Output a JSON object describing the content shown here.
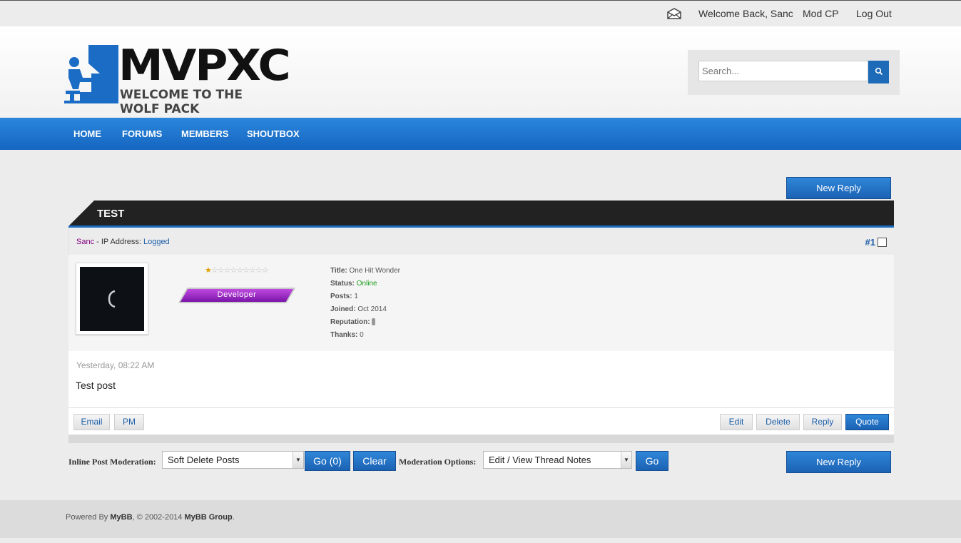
{
  "topbar": {
    "welcome": "Welcome Back, Sanc",
    "modcp": "Mod CP",
    "logout": "Log Out",
    "mail_icon": "envelope-icon"
  },
  "header": {
    "logo_main": "MVPXC",
    "logo_tagline": "WELCOME TO THE WOLF PACK",
    "search_placeholder": "Search...",
    "search_icon": "search-icon"
  },
  "nav": {
    "items": [
      "HOME",
      "FORUMS",
      "MEMBERS",
      "SHOUTBOX"
    ]
  },
  "thread": {
    "title": "TEST",
    "new_reply": "New Reply"
  },
  "post": {
    "author": "Sanc",
    "ip_label": " - IP Address: ",
    "ip_value": "Logged",
    "number": "#1",
    "stars": {
      "filled": 1,
      "total": 10
    },
    "usergroup": "Developer",
    "details": {
      "title_label": "Title:",
      "title_value": "One Hit Wonder",
      "status_label": "Status:",
      "status_value": "Online",
      "posts_label": "Posts:",
      "posts_value": "1",
      "joined_label": "Joined:",
      "joined_value": "Oct 2014",
      "rep_label": "Reputation:",
      "thanks_label": "Thanks:",
      "thanks_value": "0"
    },
    "date": "Yesterday, 08:22 AM",
    "body": "Test post",
    "buttons": {
      "email": "Email",
      "pm": "PM",
      "edit": "Edit",
      "delete": "Delete",
      "reply": "Reply",
      "quote": "Quote"
    }
  },
  "moderation": {
    "inline_label": "Inline Post Moderation:",
    "inline_selected": "Soft Delete Posts",
    "go_count": "Go (0)",
    "clear": "Clear",
    "options_label": "Moderation Options:",
    "options_selected": "Edit / View Thread Notes",
    "go": "Go"
  },
  "footer": {
    "powered_by": "Powered By ",
    "mybb": "MyBB",
    "copyright": ", © 2002-2014 ",
    "group": "MyBB Group",
    "end": "."
  },
  "colors": {
    "accent_blue": "#1b6cc4",
    "nav_blue": "#2b86dc",
    "thread_header": "#222222",
    "online_green": "#1a9c1a",
    "badge_purple": "#9b2ad0"
  }
}
